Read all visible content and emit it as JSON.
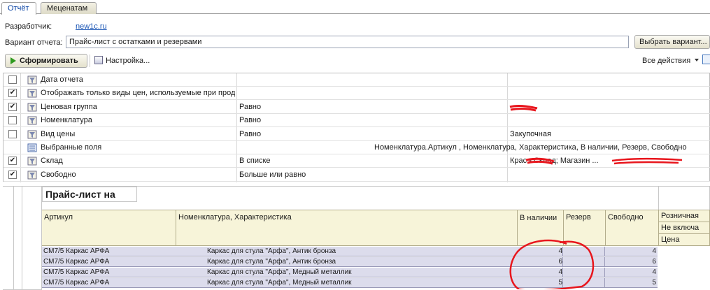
{
  "tabs": [
    "Отчёт",
    "Меценатам"
  ],
  "developer": {
    "label": "Разработчик:",
    "link": "new1c.ru"
  },
  "variant": {
    "label": "Вариант отчета:",
    "value": "Прайс-лист с остатками и резервами",
    "choose_label": "Выбрать вариант..."
  },
  "toolbar": {
    "generate_label": "Сформировать",
    "settings_label": "Настройка...",
    "all_actions_label": "Все действия"
  },
  "settings": [
    {
      "checked": false,
      "field": "Дата отчета",
      "condition": "",
      "value": "",
      "icon": "filter-icon"
    },
    {
      "checked": true,
      "field": "Отображать только виды цен, используемые при продаже",
      "condition": "",
      "value": "",
      "icon": "filter-icon"
    },
    {
      "checked": true,
      "field": "Ценовая группа",
      "condition": "Равно",
      "value": "",
      "icon": "filter-icon"
    },
    {
      "checked": false,
      "field": "Номенклатура",
      "condition": "Равно",
      "value": "",
      "icon": "filter-icon"
    },
    {
      "checked": false,
      "field": "Вид цены",
      "condition": "Равно",
      "value": "Закупочная",
      "icon": "filter-icon"
    },
    {
      "checked": null,
      "field": "Выбранные поля",
      "condition": "",
      "value": "Номенклатура.Артикул , Номенклатура, Характеристика, В наличии, Резерв, Свободно",
      "icon": "fields-icon"
    },
    {
      "checked": true,
      "field": "Склад",
      "condition": "В списке",
      "value": "Крас - Склад; Магазин ...",
      "icon": "filter-icon"
    },
    {
      "checked": true,
      "field": "Свободно",
      "condition": "Больше или равно",
      "value": "",
      "icon": "filter-icon"
    }
  ],
  "report": {
    "title": "Прайс-лист на",
    "headers": {
      "article": "Артикул",
      "nomenclature": "Номенклатура, Характеристика",
      "in_stock": "В наличии",
      "reserve": "Резерв",
      "free": "Свободно",
      "retail": "Розничная",
      "retail_sub": "Не включа",
      "price": "Цена"
    },
    "rows": [
      {
        "article": "СМ7/5 Каркас АРФА",
        "name": "Каркас для стула \"Арфа\", Антик бронза",
        "in_stock": "4",
        "reserve": "",
        "free": "4"
      },
      {
        "article": "СМ7/5 Каркас АРФА",
        "name": "Каркас для стула \"Арфа\", Антик бронза",
        "in_stock": "6",
        "reserve": "",
        "free": "6"
      },
      {
        "article": "СМ7/5 Каркас АРФА",
        "name": "Каркас для стула \"Арфа\", Медный металлик",
        "in_stock": "4",
        "reserve": "",
        "free": "4"
      },
      {
        "article": "СМ7/5 Каркас АРФА",
        "name": "Каркас для стула \"Арфа\", Медный металлик",
        "in_stock": "5",
        "reserve": "",
        "free": "5"
      }
    ]
  },
  "colors": {
    "accent": "#1a55b5",
    "header_bg": "#f7f4d9",
    "row_bg": "#dcdcec",
    "annotation": "#e8161d"
  }
}
